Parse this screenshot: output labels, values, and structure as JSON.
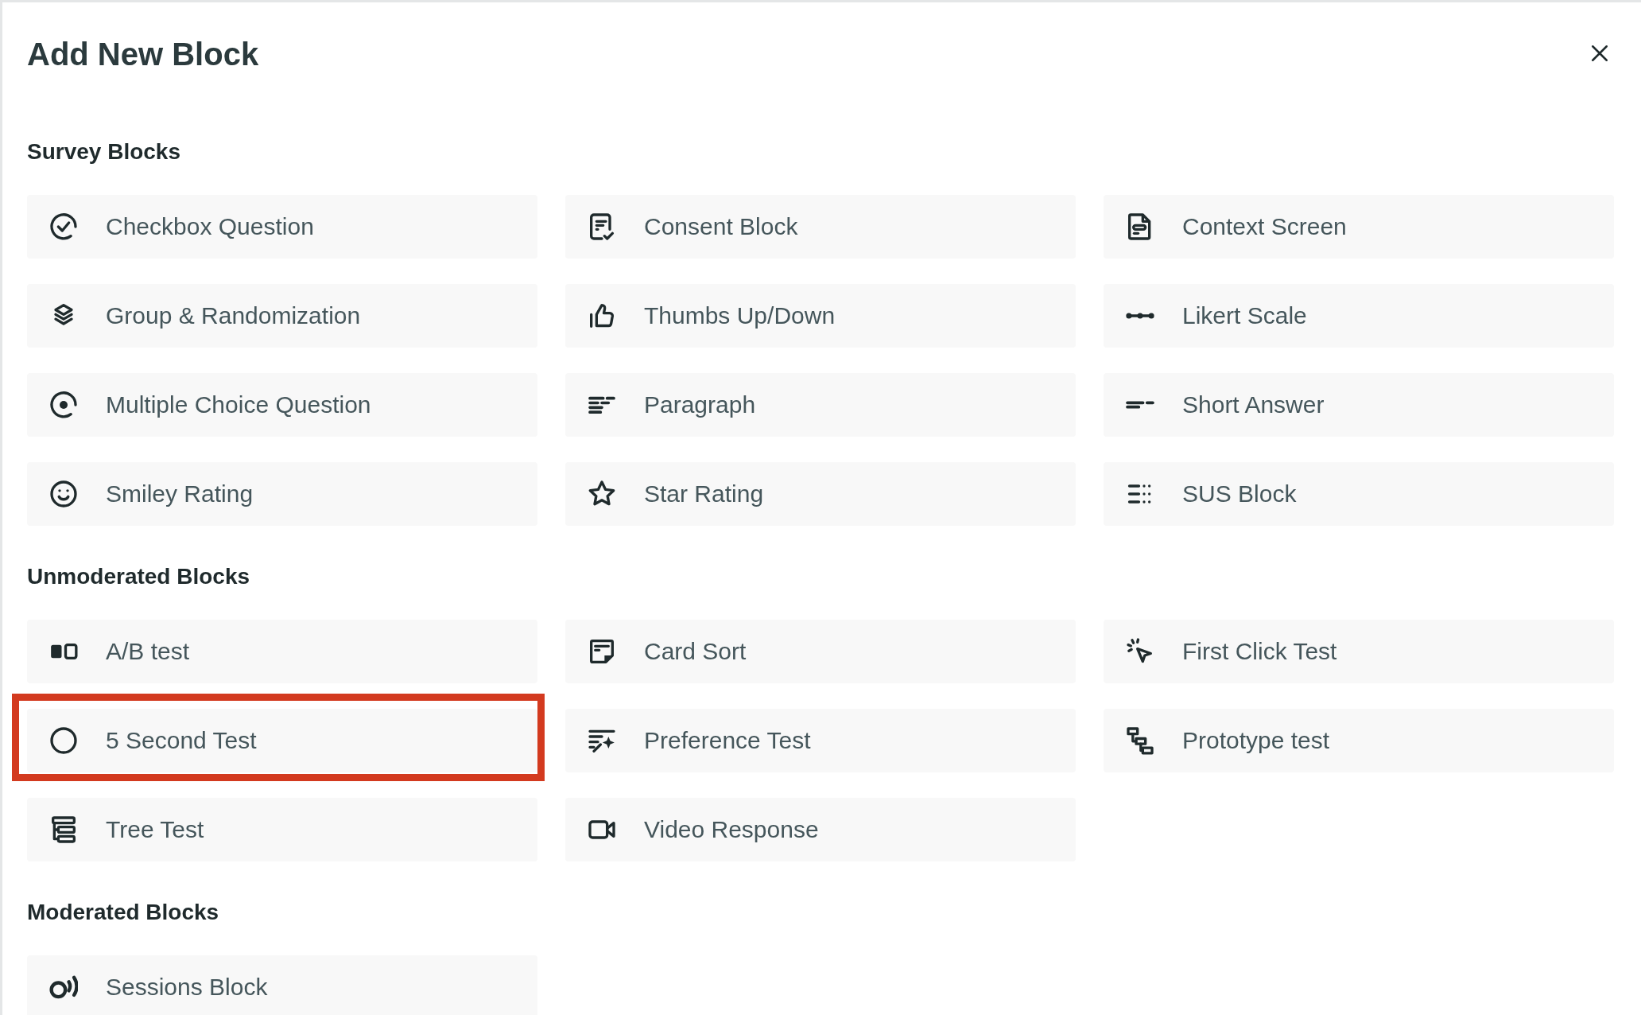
{
  "dialog": {
    "title": "Add New Block"
  },
  "sections": [
    {
      "heading": "Survey Blocks",
      "items": [
        {
          "label": "Checkbox Question",
          "highlighted": false
        },
        {
          "label": "Consent Block",
          "highlighted": false
        },
        {
          "label": "Context Screen",
          "highlighted": false
        },
        {
          "label": "Group & Randomization",
          "highlighted": false
        },
        {
          "label": "Thumbs Up/Down",
          "highlighted": false
        },
        {
          "label": "Likert Scale",
          "highlighted": false
        },
        {
          "label": "Multiple Choice Question",
          "highlighted": false
        },
        {
          "label": "Paragraph",
          "highlighted": false
        },
        {
          "label": "Short Answer",
          "highlighted": false
        },
        {
          "label": "Smiley Rating",
          "highlighted": false
        },
        {
          "label": "Star Rating",
          "highlighted": false
        },
        {
          "label": "SUS Block",
          "highlighted": false
        }
      ]
    },
    {
      "heading": "Unmoderated Blocks",
      "items": [
        {
          "label": "A/B test",
          "highlighted": false
        },
        {
          "label": "Card Sort",
          "highlighted": false
        },
        {
          "label": "First Click Test",
          "highlighted": false
        },
        {
          "label": "5 Second Test",
          "highlighted": true
        },
        {
          "label": "Preference Test",
          "highlighted": false
        },
        {
          "label": "Prototype test",
          "highlighted": false
        },
        {
          "label": "Tree Test",
          "highlighted": false
        },
        {
          "label": "Video Response",
          "highlighted": false
        }
      ]
    },
    {
      "heading": "Moderated Blocks",
      "items": [
        {
          "label": "Sessions Block",
          "highlighted": false
        }
      ]
    }
  ]
}
